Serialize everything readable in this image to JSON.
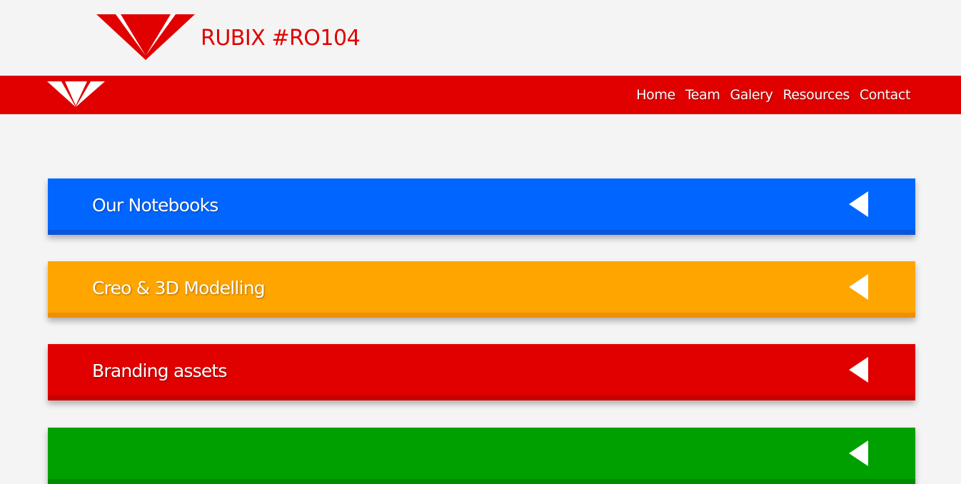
{
  "header": {
    "title": "RUBIX #RO104"
  },
  "nav": {
    "items": [
      {
        "label": "Home"
      },
      {
        "label": "Team"
      },
      {
        "label": "Galery"
      },
      {
        "label": "Resources"
      },
      {
        "label": "Contact"
      }
    ]
  },
  "panels": [
    {
      "label": "Our Notebooks",
      "color": "#0066ff",
      "edge_color": "#0a55dd",
      "arrow_icon": "caret-left-icon"
    },
    {
      "label": "Creo & 3D Modelling",
      "color": "#ffa500",
      "edge_color": "#ee8f0a",
      "arrow_icon": "caret-left-icon"
    },
    {
      "label": "Branding assets",
      "color": "#e00000",
      "edge_color": "#c80000",
      "arrow_icon": "caret-left-icon"
    },
    {
      "label": "",
      "color": "#00a000",
      "edge_color": "#008a00",
      "arrow_icon": "caret-left-icon"
    }
  ],
  "colors": {
    "brand_red": "#e00000",
    "background": "#f4f4f4"
  },
  "icons": {
    "logo": "rubix-logo-icon"
  }
}
